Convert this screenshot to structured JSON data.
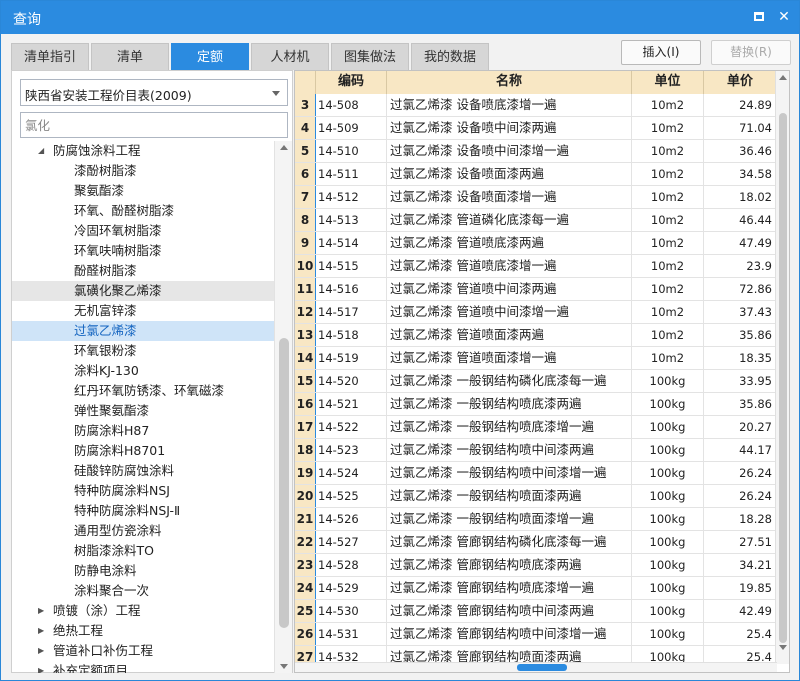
{
  "window": {
    "title": "查询"
  },
  "tabs": [
    {
      "label": "清单指引"
    },
    {
      "label": "清单"
    },
    {
      "label": "定额"
    },
    {
      "label": "人材机"
    },
    {
      "label": "图集做法"
    },
    {
      "label": "我的数据"
    }
  ],
  "active_tab": "定额",
  "buttons": {
    "insert": "插入(I)",
    "replace": "替换(R)"
  },
  "library": {
    "selected": "陕西省安装工程价目表(2009)"
  },
  "search": {
    "value": "",
    "placeholder": "氯化"
  },
  "tree": [
    {
      "label": "防腐蚀涂料工程",
      "level": 1,
      "toggle": "expanded"
    },
    {
      "label": "漆酚树脂漆",
      "level": 2
    },
    {
      "label": "聚氨酯漆",
      "level": 2
    },
    {
      "label": "环氧、酚醛树脂漆",
      "level": 2
    },
    {
      "label": "冷固环氧树脂漆",
      "level": 2
    },
    {
      "label": "环氧呋喃树脂漆",
      "level": 2
    },
    {
      "label": "酚醛树脂漆",
      "level": 2
    },
    {
      "label": "氯磺化聚乙烯漆",
      "level": 2,
      "state": "hover"
    },
    {
      "label": "无机富锌漆",
      "level": 2
    },
    {
      "label": "过氯乙烯漆",
      "level": 2,
      "state": "selected"
    },
    {
      "label": "环氧银粉漆",
      "level": 2
    },
    {
      "label": "涂料KJ-130",
      "level": 2
    },
    {
      "label": "红丹环氧防锈漆、环氧磁漆",
      "level": 2
    },
    {
      "label": "弹性聚氨酯漆",
      "level": 2
    },
    {
      "label": "防腐涂料H87",
      "level": 2
    },
    {
      "label": "防腐涂料H8701",
      "level": 2
    },
    {
      "label": "硅酸锌防腐蚀涂料",
      "level": 2
    },
    {
      "label": "特种防腐涂料NSJ",
      "level": 2
    },
    {
      "label": "特种防腐涂料NSJ-Ⅱ",
      "level": 2
    },
    {
      "label": "通用型仿瓷涂料",
      "level": 2
    },
    {
      "label": "树脂漆涂料TO",
      "level": 2
    },
    {
      "label": "防静电涂料",
      "level": 2
    },
    {
      "label": "涂料聚合一次",
      "level": 2
    },
    {
      "label": "喷镀（涂）工程",
      "level": 1,
      "toggle": "collapsed"
    },
    {
      "label": "绝热工程",
      "level": 1,
      "toggle": "collapsed"
    },
    {
      "label": "管道补口补伤工程",
      "level": 1,
      "toggle": "collapsed"
    },
    {
      "label": "补充定额项目",
      "level": 1,
      "toggle": "collapsed"
    }
  ],
  "grid": {
    "columns": [
      "编码",
      "名称",
      "单位",
      "单价"
    ],
    "rows": [
      {
        "idx": "3",
        "code": "14-508",
        "name": "过氯乙烯漆 设备喷底漆增一遍",
        "unit": "10m2",
        "price": "24.89"
      },
      {
        "idx": "4",
        "code": "14-509",
        "name": "过氯乙烯漆 设备喷中间漆两遍",
        "unit": "10m2",
        "price": "71.04"
      },
      {
        "idx": "5",
        "code": "14-510",
        "name": "过氯乙烯漆 设备喷中间漆增一遍",
        "unit": "10m2",
        "price": "36.46"
      },
      {
        "idx": "6",
        "code": "14-511",
        "name": "过氯乙烯漆 设备喷面漆两遍",
        "unit": "10m2",
        "price": "34.58"
      },
      {
        "idx": "7",
        "code": "14-512",
        "name": "过氯乙烯漆 设备喷面漆增一遍",
        "unit": "10m2",
        "price": "18.02"
      },
      {
        "idx": "8",
        "code": "14-513",
        "name": "过氯乙烯漆 管道磷化底漆每一遍",
        "unit": "10m2",
        "price": "46.44"
      },
      {
        "idx": "9",
        "code": "14-514",
        "name": "过氯乙烯漆 管道喷底漆两遍",
        "unit": "10m2",
        "price": "47.49"
      },
      {
        "idx": "10",
        "code": "14-515",
        "name": "过氯乙烯漆 管道喷底漆增一遍",
        "unit": "10m2",
        "price": "23.9"
      },
      {
        "idx": "11",
        "code": "14-516",
        "name": "过氯乙烯漆 管道喷中间漆两遍",
        "unit": "10m2",
        "price": "72.86"
      },
      {
        "idx": "12",
        "code": "14-517",
        "name": "过氯乙烯漆 管道喷中间漆增一遍",
        "unit": "10m2",
        "price": "37.43"
      },
      {
        "idx": "13",
        "code": "14-518",
        "name": "过氯乙烯漆 管道喷面漆两遍",
        "unit": "10m2",
        "price": "35.86"
      },
      {
        "idx": "14",
        "code": "14-519",
        "name": "过氯乙烯漆 管道喷面漆增一遍",
        "unit": "10m2",
        "price": "18.35"
      },
      {
        "idx": "15",
        "code": "14-520",
        "name": "过氯乙烯漆 一般钢结构磷化底漆每一遍",
        "unit": "100kg",
        "price": "33.95"
      },
      {
        "idx": "16",
        "code": "14-521",
        "name": "过氯乙烯漆 一般钢结构喷底漆两遍",
        "unit": "100kg",
        "price": "35.86"
      },
      {
        "idx": "17",
        "code": "14-522",
        "name": "过氯乙烯漆 一般钢结构喷底漆增一遍",
        "unit": "100kg",
        "price": "20.27"
      },
      {
        "idx": "18",
        "code": "14-523",
        "name": "过氯乙烯漆 一般钢结构喷中间漆两遍",
        "unit": "100kg",
        "price": "44.17"
      },
      {
        "idx": "19",
        "code": "14-524",
        "name": "过氯乙烯漆 一般钢结构喷中间漆增一遍",
        "unit": "100kg",
        "price": "26.24"
      },
      {
        "idx": "20",
        "code": "14-525",
        "name": "过氯乙烯漆 一般钢结构喷面漆两遍",
        "unit": "100kg",
        "price": "26.24"
      },
      {
        "idx": "21",
        "code": "14-526",
        "name": "过氯乙烯漆 一般钢结构喷面漆增一遍",
        "unit": "100kg",
        "price": "18.28"
      },
      {
        "idx": "22",
        "code": "14-527",
        "name": "过氯乙烯漆 管廊钢结构磷化底漆每一遍",
        "unit": "100kg",
        "price": "27.51"
      },
      {
        "idx": "23",
        "code": "14-528",
        "name": "过氯乙烯漆 管廊钢结构喷底漆两遍",
        "unit": "100kg",
        "price": "34.21"
      },
      {
        "idx": "24",
        "code": "14-529",
        "name": "过氯乙烯漆 管廊钢结构喷底漆增一遍",
        "unit": "100kg",
        "price": "19.85"
      },
      {
        "idx": "25",
        "code": "14-530",
        "name": "过氯乙烯漆 管廊钢结构喷中间漆两遍",
        "unit": "100kg",
        "price": "42.49"
      },
      {
        "idx": "26",
        "code": "14-531",
        "name": "过氯乙烯漆 管廊钢结构喷中间漆增一遍",
        "unit": "100kg",
        "price": "25.4"
      },
      {
        "idx": "27",
        "code": "14-532",
        "name": "过氯乙烯漆 管廊钢结构喷面漆两遍",
        "unit": "100kg",
        "price": "25.4"
      }
    ]
  },
  "colors": {
    "accent": "#2b8be0",
    "header_bg": "#f8e7c4",
    "selected_row": "#cfe4f8"
  }
}
